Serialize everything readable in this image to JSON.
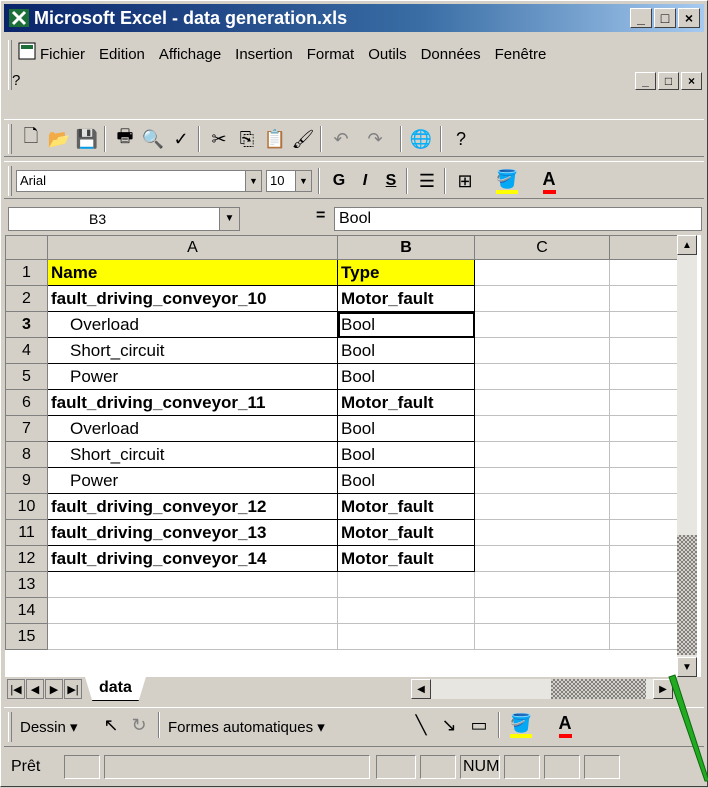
{
  "window": {
    "title": "Microsoft Excel - data generation.xls",
    "minimize": "_",
    "maximize": "□",
    "close": "×"
  },
  "menu": {
    "items": [
      "Fichier",
      "Edition",
      "Affichage",
      "Insertion",
      "Format",
      "Outils",
      "Données",
      "Fenêtre",
      "?"
    ]
  },
  "font": {
    "name": "Arial",
    "size": "10",
    "bold": "G",
    "italic": "I",
    "underline": "S"
  },
  "formula": {
    "cell_ref": "B3",
    "equals": "=",
    "value": "Bool"
  },
  "columns": [
    "A",
    "B",
    "C"
  ],
  "rows": [
    {
      "n": "1",
      "a": "Name",
      "b": "Type",
      "style": "header"
    },
    {
      "n": "2",
      "a": "fault_driving_conveyor_10",
      "b": "Motor_fault",
      "style": "bold"
    },
    {
      "n": "3",
      "a": "Overload",
      "b": "Bool",
      "style": "indent"
    },
    {
      "n": "4",
      "a": "Short_circuit",
      "b": "Bool",
      "style": "indent"
    },
    {
      "n": "5",
      "a": "Power",
      "b": "Bool",
      "style": "indent"
    },
    {
      "n": "6",
      "a": "fault_driving_conveyor_11",
      "b": "Motor_fault",
      "style": "bold"
    },
    {
      "n": "7",
      "a": "Overload",
      "b": "Bool",
      "style": "indent"
    },
    {
      "n": "8",
      "a": "Short_circuit",
      "b": "Bool",
      "style": "indent"
    },
    {
      "n": "9",
      "a": "Power",
      "b": "Bool",
      "style": "indent"
    },
    {
      "n": "10",
      "a": "fault_driving_conveyor_12",
      "b": "Motor_fault",
      "style": "bold"
    },
    {
      "n": "11",
      "a": "fault_driving_conveyor_13",
      "b": "Motor_fault",
      "style": "bold"
    },
    {
      "n": "12",
      "a": "fault_driving_conveyor_14",
      "b": "Motor_fault",
      "style": "bold"
    },
    {
      "n": "13",
      "a": "",
      "b": "",
      "style": "empty"
    },
    {
      "n": "14",
      "a": "",
      "b": "",
      "style": "empty"
    },
    {
      "n": "15",
      "a": "",
      "b": "",
      "style": "empty"
    }
  ],
  "selected_cell": {
    "row": "3",
    "col": "B"
  },
  "sheet_tab": "data",
  "drawing": {
    "dessin": "Dessin",
    "formes": "Formes automatiques"
  },
  "status": {
    "ready": "Prêt",
    "num": "NUM"
  },
  "colors": {
    "title_start": "#0a246a",
    "title_end": "#a6caf0",
    "header_fill": "#ffff00",
    "chrome": "#d4d0c8"
  }
}
